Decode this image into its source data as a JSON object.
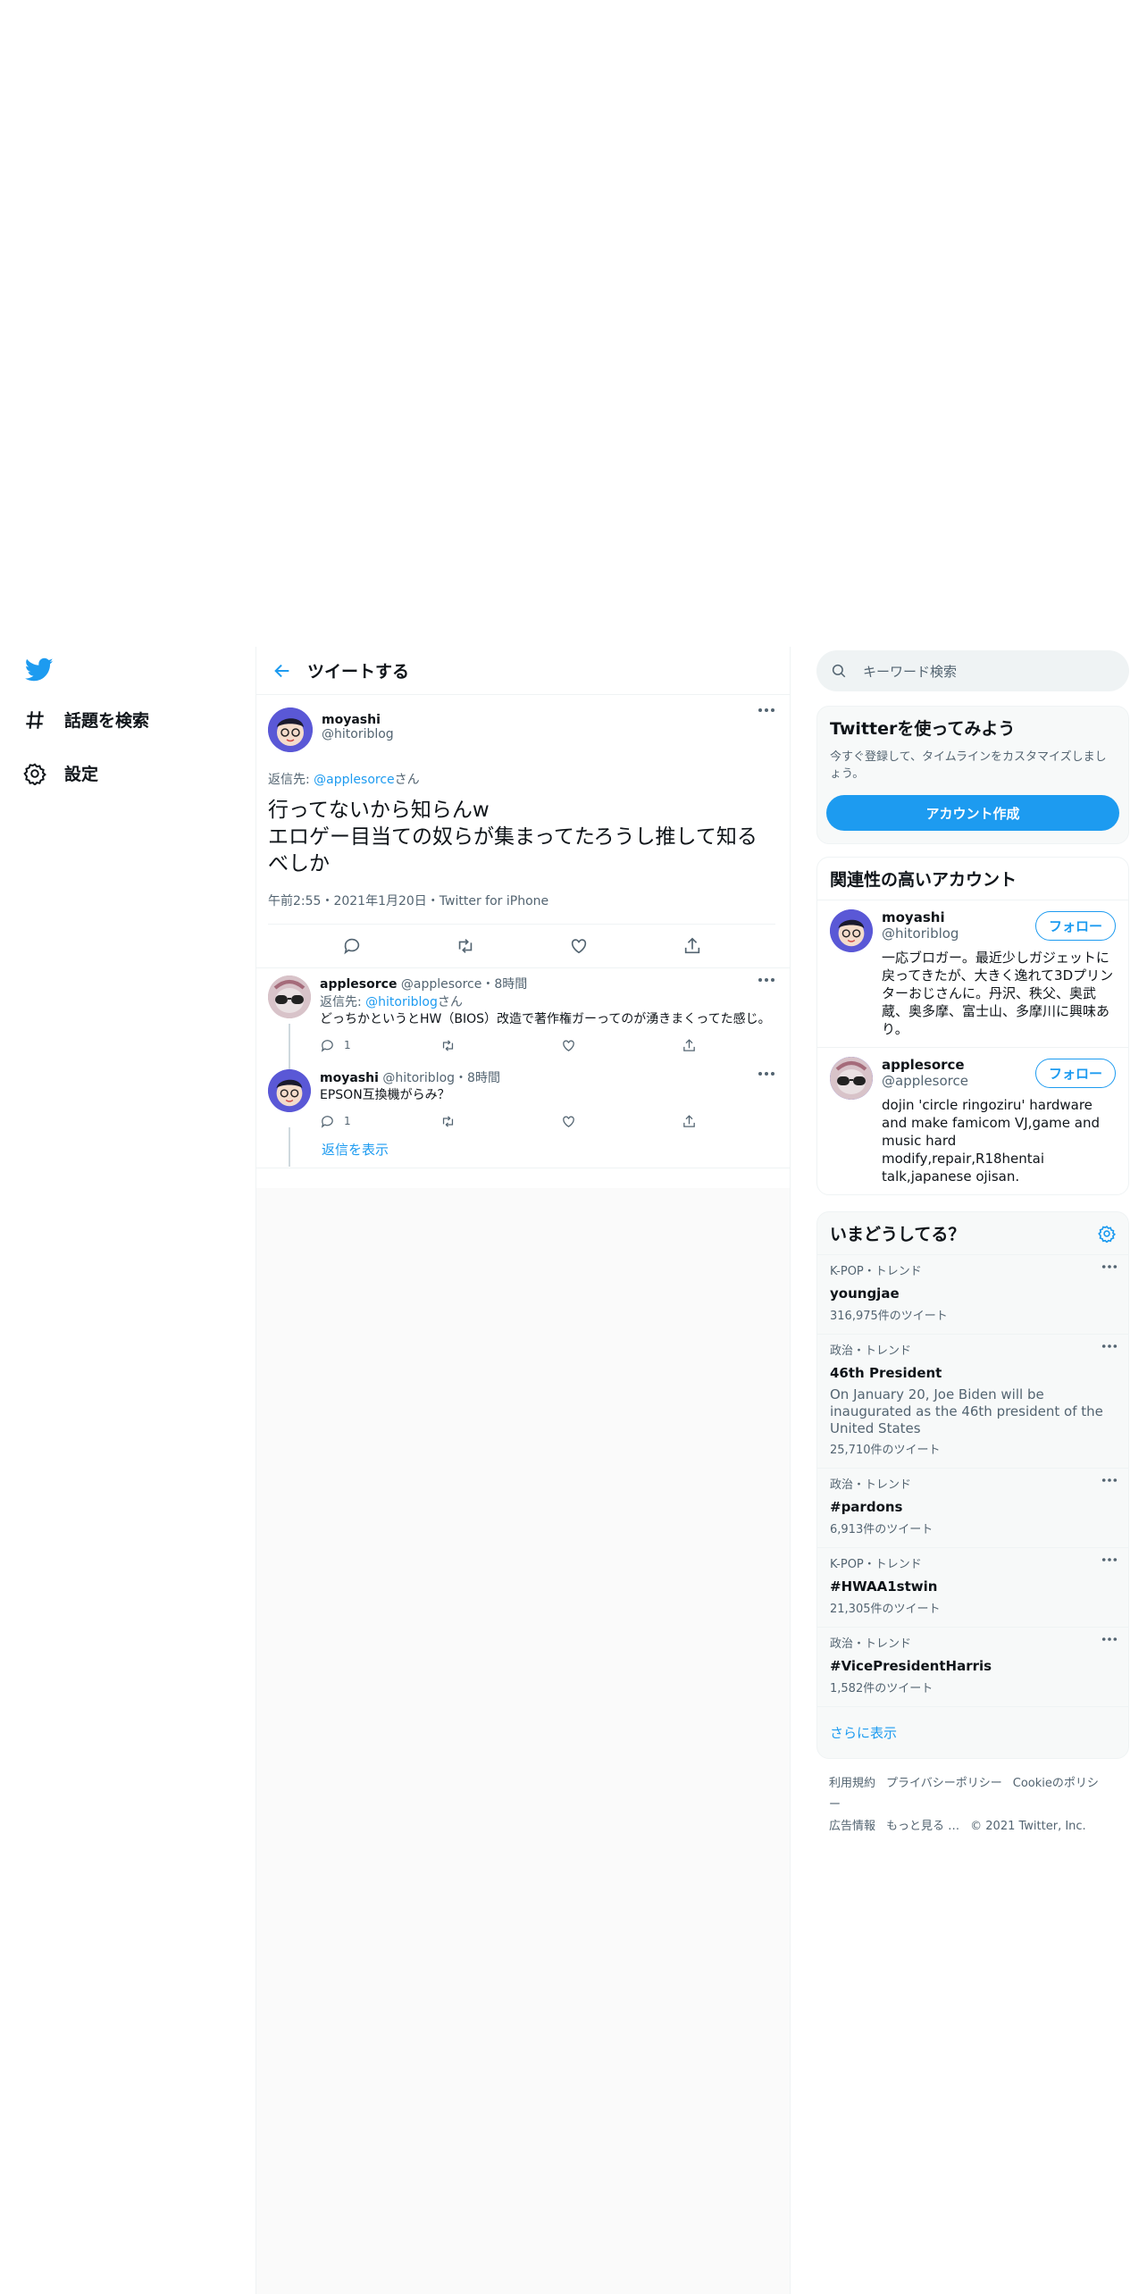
{
  "nav": {
    "logo_icon": "twitter-bird-icon",
    "items": [
      {
        "label": "話題を検索",
        "icon": "hashtag-icon"
      },
      {
        "label": "設定",
        "icon": "gear-icon"
      }
    ]
  },
  "main": {
    "header_title": "ツイートする",
    "focal": {
      "name": "moyashi",
      "handle": "@hitoriblog",
      "replying_prefix": "返信先: ",
      "replying_to": "@applesorce",
      "replying_suffix": "さん",
      "text": "行ってないから知らんw\nエロゲー目当ての奴らが集まってたろうし推して知るべしか",
      "meta": "午前2:55・2021年1月20日・Twitter for iPhone"
    },
    "replies": [
      {
        "name": "applesorce",
        "handle_time": "@applesorce・8時間",
        "replying_prefix": "返信先: ",
        "replying_to": "@hitoriblog",
        "replying_suffix": "さん",
        "text": "どっちかというとHW（BIOS）改造で著作権ガーってのが湧きまくってた感じ。",
        "reply_count": "1",
        "like_count": ""
      },
      {
        "name": "moyashi",
        "handle_time": "@hitoriblog・8時間",
        "text": "EPSON互換機がらみ？",
        "reply_count": "1"
      }
    ],
    "show_replies": "返信を表示"
  },
  "right": {
    "search_placeholder": "キーワード検索",
    "signup": {
      "title": "Twitterを使ってみよう",
      "desc": "今すぐ登録して、タイムラインをカスタマイズしましょう。",
      "button": "アカウント作成"
    },
    "relevant": {
      "title": "関連性の高いアカウント",
      "follow_label": "フォロー",
      "accounts": [
        {
          "name": "moyashi",
          "handle": "@hitoriblog",
          "bio": "一応ブロガー。最近少しガジェットに戻ってきたが、大きく逸れて3Dプリンターおじさんに。丹沢、秩父、奥武蔵、奥多摩、富士山、多摩川に興味あり。"
        },
        {
          "name": "applesorce",
          "handle": "@applesorce",
          "bio": "dojin 'circle ringoziru' hardware and make famicom VJ,game and music hard modify,repair,R18hentai talk,japanese ojisan."
        }
      ]
    },
    "trends": {
      "title": "いまどうしてる？",
      "items": [
        {
          "meta": "K-POP・トレンド",
          "name": "youngjae",
          "desc": "",
          "count": "316,975件のツイート"
        },
        {
          "meta": "政治・トレンド",
          "name": "46th President",
          "desc": "On January 20, Joe Biden will be inaugurated as the 46th president of the United States",
          "count": "25,710件のツイート"
        },
        {
          "meta": "政治・トレンド",
          "name": "#pardons",
          "desc": "",
          "count": "6,913件のツイート"
        },
        {
          "meta": "K-POP・トレンド",
          "name": "#HWAA1stwin",
          "desc": "",
          "count": "21,305件のツイート"
        },
        {
          "meta": "政治・トレンド",
          "name": "#VicePresidentHarris",
          "desc": "",
          "count": "1,582件のツイート"
        }
      ],
      "show_more": "さらに表示"
    },
    "footer": {
      "links": [
        "利用規約",
        "プライバシーポリシー",
        "Cookieのポリシー",
        "広告情報",
        "もっと見る …"
      ],
      "copyright": "© 2021 Twitter, Inc."
    }
  },
  "colors": {
    "accent": "#1d9bf0",
    "text": "#0f1419",
    "muted": "#536471",
    "border": "#eff3f4"
  }
}
